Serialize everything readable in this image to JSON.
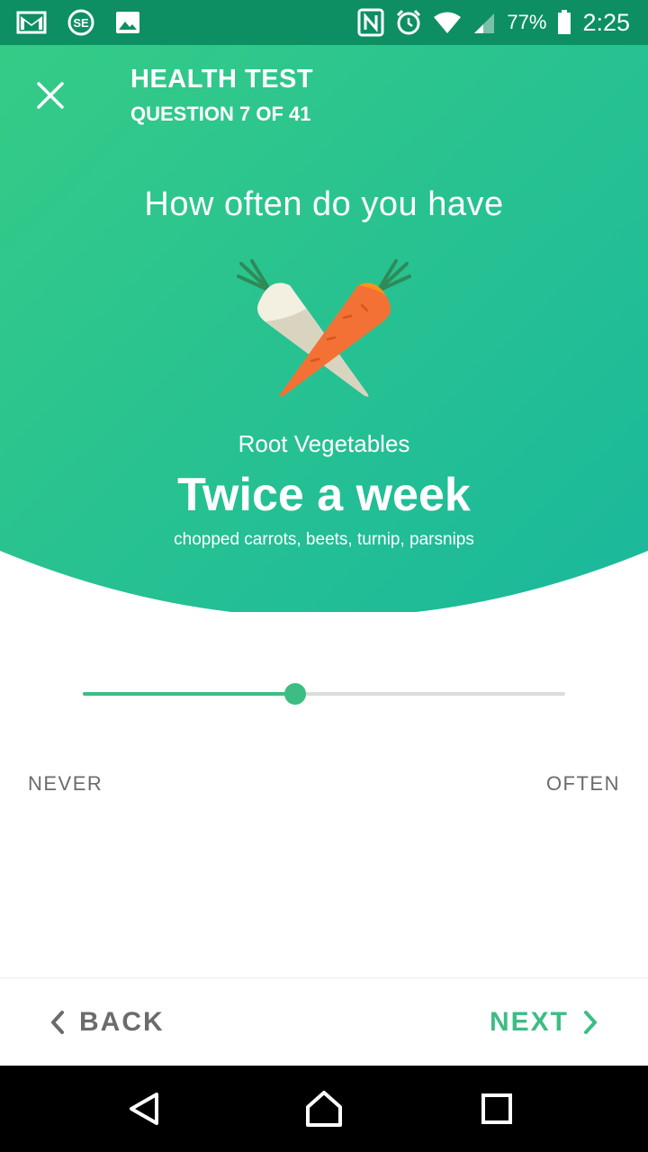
{
  "status_bar": {
    "icons_left": [
      "gmail-icon",
      "notification-app-icon",
      "gallery-icon"
    ],
    "icons_right": [
      "nfc-icon",
      "alarm-icon",
      "wifi-icon",
      "signal-icon",
      "battery-icon"
    ],
    "battery_percent": "77%",
    "battery_level": 0.77,
    "time": "2:25"
  },
  "header": {
    "title": "HEALTH TEST",
    "subtitle": "QUESTION 7 OF 41",
    "close_icon": "close-icon"
  },
  "question": {
    "text": "How often do you have",
    "illustration": "root-vegetables-illustration",
    "category": "Root Vegetables",
    "answer": "Twice a week",
    "examples": "chopped carrots, beets, turnip, parsnips"
  },
  "slider": {
    "value_fraction": 0.44,
    "min_label": "NEVER",
    "max_label": "OFTEN"
  },
  "footer": {
    "back_label": "BACK",
    "next_label": "NEXT"
  },
  "colors": {
    "accent": "#3dbd84",
    "hero_start": "#34c987",
    "hero_end": "#1db89a",
    "status_bar": "#0d8f63",
    "muted_text": "#6b6b6b"
  },
  "nav_bar": {
    "buttons": [
      "back-triangle-icon",
      "home-icon",
      "recents-icon"
    ]
  }
}
